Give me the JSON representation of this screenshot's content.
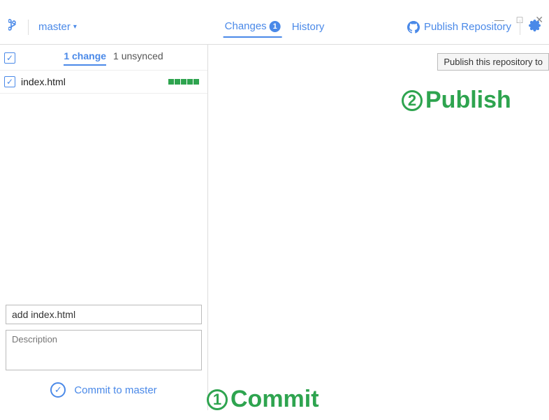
{
  "window": {
    "min": "—",
    "max": "□",
    "close": "✕"
  },
  "topbar": {
    "branch_name": "master",
    "tabs": {
      "changes": "Changes",
      "changes_badge": "1",
      "history": "History"
    },
    "publish_label": "Publish Repository",
    "tooltip": "Publish this repository to"
  },
  "sidebar": {
    "summary": {
      "changes": "1 change",
      "unsynced": "1 unsynced"
    },
    "files": [
      {
        "name": "index.html"
      }
    ],
    "commit": {
      "summary_value": "add index.html",
      "description_placeholder": "Description",
      "button_label": "Commit to master"
    }
  },
  "annotations": {
    "commit": "Commit",
    "publish": "Publish",
    "num1": "1",
    "num2": "2"
  }
}
